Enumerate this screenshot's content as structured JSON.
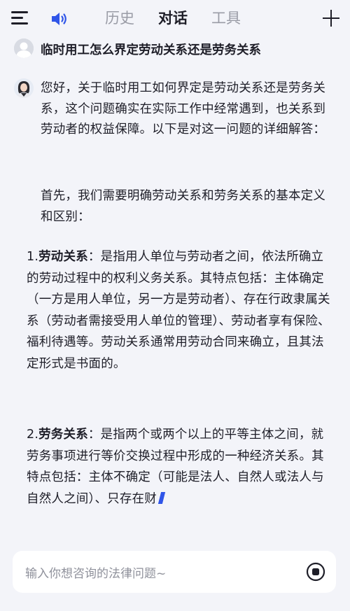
{
  "header": {
    "menu_icon": "menu-icon",
    "speaker_icon": "speaker-icon",
    "tabs": [
      {
        "label": "历史",
        "active": false
      },
      {
        "label": "对话",
        "active": true
      },
      {
        "label": "工具",
        "active": false
      }
    ],
    "new_chat_icon": "plus-icon"
  },
  "question": {
    "text": "临时用工怎么界定劳动关系还是劳务关系"
  },
  "answer": {
    "intro": "您好，关于临时用工如何界定是劳动关系还是劳务关系，这个问题确实在实际工作中经常遇到，也关系到劳动者的权益保障。以下是对这一问题的详细解答：",
    "para2": "首先，我们需要明确劳动关系和劳务关系的基本定义和区别：",
    "items": [
      {
        "num": "1.",
        "term": "劳动关系",
        "text": "：是指用人单位与劳动者之间，依法所确立的劳动过程中的权利义务关系。其特点包括：主体确定（一方是用人单位，另一方是劳动者）、存在行政隶属关系（劳动者需接受用人单位的管理）、劳动者享有保险、福利待遇等。劳动关系通常用劳动合同来确立，且其法定形式是书面的。"
      },
      {
        "num": "2.",
        "term": "劳务关系",
        "text": "：是指两个或两个以上的平等主体之间，就劳务事项进行等价交换过程中形成的一种经济关系。其特点包括：主体不确定（可能是法人、自然人或法人与自然人之间）、只存在财"
      }
    ]
  },
  "input": {
    "placeholder": "输入你想咨询的法律问题~",
    "stop_icon": "stop-icon"
  },
  "colors": {
    "background": "#f3f4f9",
    "accent": "#2f55e8",
    "text": "#1e1e28",
    "muted": "#9a9ca6"
  }
}
